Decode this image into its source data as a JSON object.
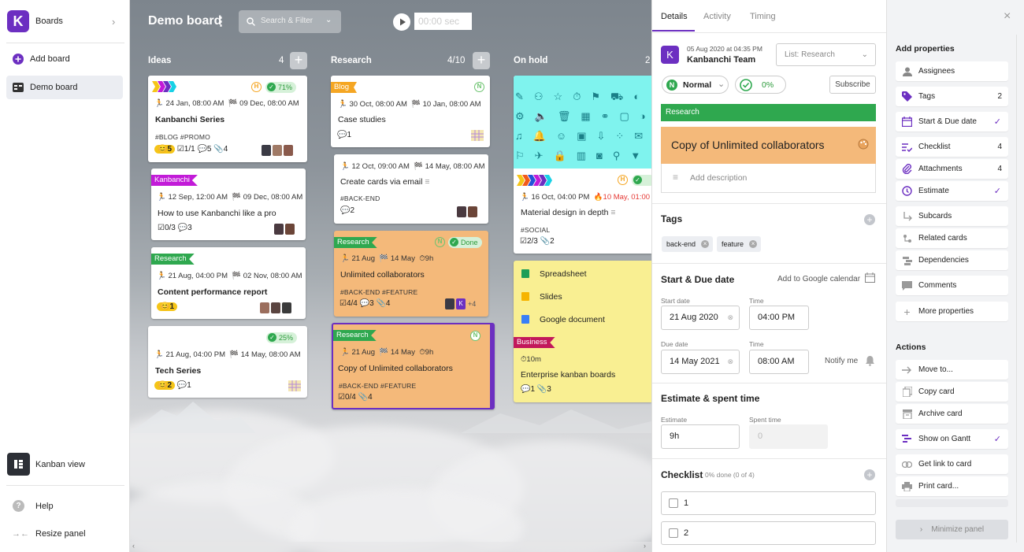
{
  "sidebar": {
    "logo_letter": "K",
    "boards_label": "Boards",
    "add_board_label": "Add board",
    "demo_board_label": "Demo board",
    "kanban_view_label": "Kanban view",
    "help_label": "Help",
    "resize_label": "Resize panel"
  },
  "board": {
    "title": "Demo board",
    "search_placeholder": "Search & Filter",
    "timer_value": "00:00 sec",
    "columns": [
      {
        "name": "Ideas",
        "count": "4"
      },
      {
        "name": "Research",
        "count": "4/10"
      },
      {
        "name": "On hold",
        "count": "2"
      }
    ]
  },
  "cards": {
    "c1": {
      "progress": "71%",
      "start": "24 Jan, 08:00 AM",
      "due": "09 Dec, 08:00 AM",
      "title": "Kanbanchi Series",
      "tags": "#BLOG  #PROMO",
      "priority_num": "5",
      "checklist": "1/1",
      "comments": "5",
      "attachments": "4"
    },
    "c2": {
      "flag": "Kanbanchi",
      "start": "12 Sep, 12:00 AM",
      "due": "09 Dec, 08:00 AM",
      "title": "How to use Kanbanchi like a pro",
      "checklist": "0/3",
      "comments": "3"
    },
    "c3": {
      "flag": "Research",
      "start": "21 Aug, 04:00 PM",
      "due": "02 Nov, 08:00 AM",
      "title": "Content performance report",
      "priority_num": "1"
    },
    "c4": {
      "progress": "25%",
      "start": "21 Aug, 04:00 PM",
      "due": "14 May, 08:00 AM",
      "title": "Tech Series",
      "priority_num": "2",
      "comments": "1"
    },
    "c5": {
      "flag": "Blog",
      "n": "N",
      "start": "30 Oct, 08:00 AM",
      "due": "10 Jan, 08:00 AM",
      "title": "Case studies",
      "comments": "1"
    },
    "c6": {
      "start": "12 Oct, 09:00 AM",
      "due": "14 May, 08:00 AM",
      "title": "Create cards via email",
      "tags": "#BACK-END",
      "comments": "2"
    },
    "c7": {
      "flag": "Research",
      "n": "N",
      "status": "Done",
      "start": "21 Aug",
      "due": "14 May",
      "estimate": "9h",
      "title": "Unlimited collaborators",
      "tags": "#BACK-END  #FEATURE",
      "checklist": "4/4",
      "comments": "3",
      "attachments": "4",
      "more": "+4",
      "avatar_letter": "K"
    },
    "c8": {
      "flag": "Research",
      "n": "N",
      "start": "21 Aug",
      "due": "14 May",
      "estimate": "9h",
      "title": "Copy of Unlimited collaborators",
      "tags": "#BACK-END  #FEATURE",
      "checklist": "0/4",
      "attachments": "4"
    },
    "c9": {
      "start": "16 Oct, 04:00 PM",
      "due": "10 May, 01:00 AM",
      "title": "Material design in depth",
      "tags": "#SOCIAL",
      "checklist": "2/3",
      "attachments": "2"
    },
    "c10": {
      "items": [
        "Spreadsheet",
        "Slides",
        "Google document"
      ],
      "flag": "Business",
      "estimate": "10m",
      "title": "Enterprise kanban boards",
      "comments": "1",
      "attachments": "3"
    }
  },
  "details": {
    "tabs": [
      "Details",
      "Activity",
      "Timing"
    ],
    "date_line": "05 Aug 2020 at 04:35 PM",
    "team": "Kanbanchi Team",
    "team_letter": "K",
    "list_select": "List: Research",
    "priority": "Normal",
    "priority_letter": "N",
    "progress": "0%",
    "subscribe": "Subscribe",
    "list_bar": "Research",
    "card_title": "Copy of Unlimited collaborators",
    "add_description": "Add description",
    "tags_title": "Tags",
    "tags": [
      "back-end",
      "feature"
    ],
    "dates_title": "Start & Due date",
    "add_google_cal": "Add to Google calendar",
    "start_date_label": "Start date",
    "start_date": "21 Aug 2020",
    "time_label": "Time",
    "start_time": "04:00 PM",
    "due_date_label": "Due date",
    "due_date": "14 May 2021",
    "due_time": "08:00 AM",
    "notify": "Notify me",
    "estimate_title": "Estimate & spent time",
    "estimate_label": "Estimate",
    "estimate_value": "9h",
    "spent_label": "Spent time",
    "spent_value": "0",
    "checklist_title": "Checklist",
    "checklist_status": "0% done (0 of 4)",
    "checklist_items": [
      "1",
      "2"
    ]
  },
  "props": {
    "add_title": "Add properties",
    "items": [
      {
        "label": "Assignees",
        "value": ""
      },
      {
        "label": "Tags",
        "value": "2"
      },
      {
        "label": "Start & Due date",
        "value": "✓"
      },
      {
        "label": "Checklist",
        "value": "4"
      },
      {
        "label": "Attachments",
        "value": "4"
      },
      {
        "label": "Estimate",
        "value": "✓"
      },
      {
        "label": "Subcards",
        "value": ""
      },
      {
        "label": "Related cards",
        "value": ""
      },
      {
        "label": "Dependencies",
        "value": ""
      },
      {
        "label": "Comments",
        "value": ""
      },
      {
        "label": "More properties",
        "value": ""
      }
    ],
    "actions_title": "Actions",
    "actions": [
      {
        "label": "Move to...",
        "value": ""
      },
      {
        "label": "Copy card",
        "value": ""
      },
      {
        "label": "Archive card",
        "value": ""
      },
      {
        "label": "Show on Gantt",
        "value": "✓"
      },
      {
        "label": "Get link to card",
        "value": ""
      },
      {
        "label": "Print card...",
        "value": ""
      }
    ],
    "minimize": "Minimize panel"
  },
  "colors": {
    "accent": "#6c2fc1",
    "green": "#2fa84f",
    "orange_card": "#f4b97a",
    "cyan_card": "#7ff3ee",
    "yellow_card": "#f9ef92"
  }
}
